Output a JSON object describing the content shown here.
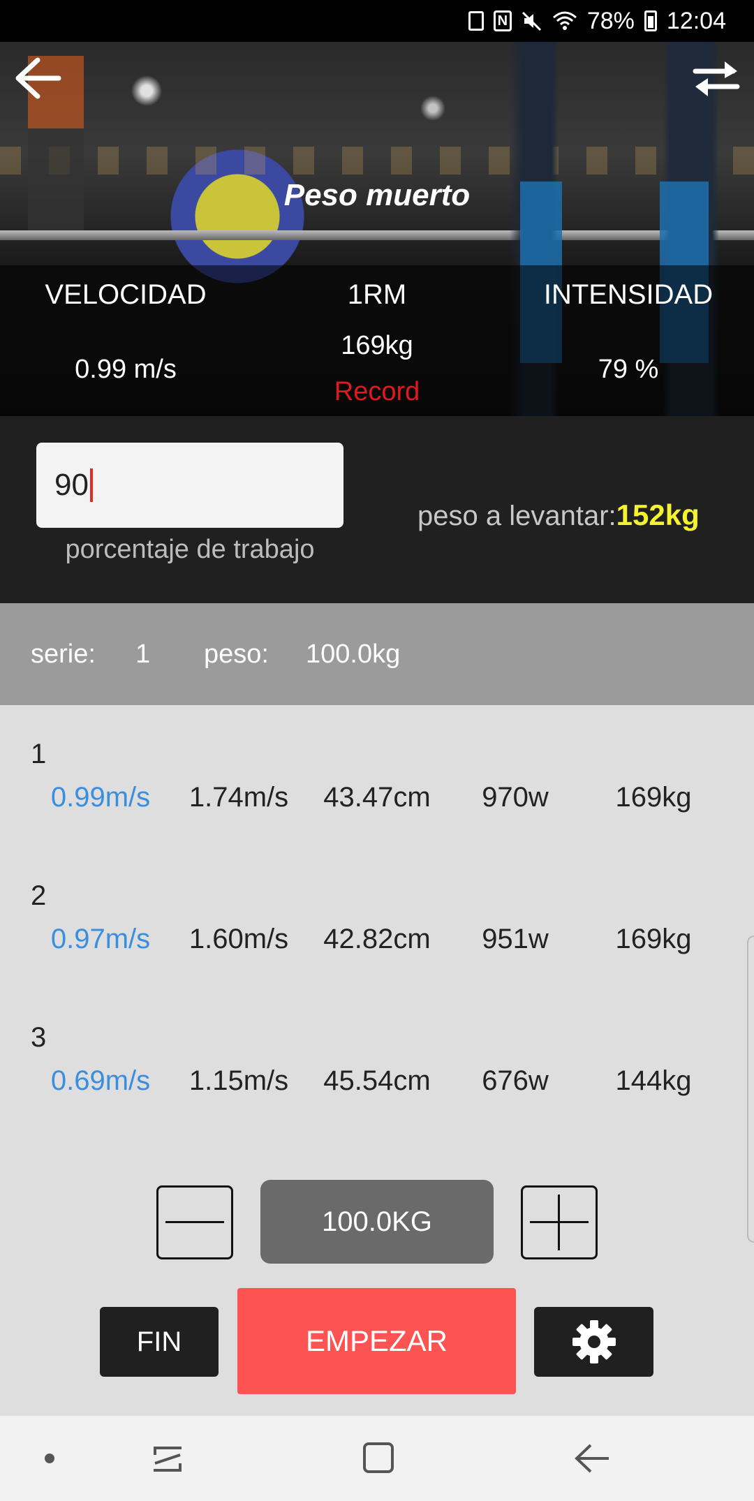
{
  "status_bar": {
    "battery": "78%",
    "time": "12:04"
  },
  "header": {
    "title": "Peso muerto"
  },
  "stats": {
    "velocity_label": "VELOCIDAD",
    "velocity_value": "0.99 m/s",
    "rm_label": "1RM",
    "rm_value": "169kg",
    "record_label": "Record",
    "intensity_label": "INTENSIDAD",
    "intensity_value": "79 %"
  },
  "work": {
    "percentage_value": "90",
    "percentage_label": "porcentaje de trabajo",
    "lift_label": "peso a levantar:",
    "lift_value": "152kg"
  },
  "serie": {
    "serie_label": "serie:",
    "serie_value": "1",
    "peso_label": "peso:",
    "peso_value": "100.0kg"
  },
  "reps": [
    {
      "num": "1",
      "mean_velocity": "0.99m/s",
      "peak_velocity": "1.74m/s",
      "distance": "43.47cm",
      "power": "970w",
      "est_1rm": "169kg"
    },
    {
      "num": "2",
      "mean_velocity": "0.97m/s",
      "peak_velocity": "1.60m/s",
      "distance": "42.82cm",
      "power": "951w",
      "est_1rm": "169kg"
    },
    {
      "num": "3",
      "mean_velocity": "0.69m/s",
      "peak_velocity": "1.15m/s",
      "distance": "45.54cm",
      "power": "676w",
      "est_1rm": "144kg"
    }
  ],
  "controls": {
    "weight_display": "100.0KG",
    "fin_label": "FIN",
    "start_label": "EMPEZAR"
  },
  "colors": {
    "accent_red": "#fd5353",
    "record_red": "#e0191f",
    "velocity_blue": "#3a8ee0",
    "lift_yellow": "#f5f230",
    "dark_panel": "#202020"
  }
}
